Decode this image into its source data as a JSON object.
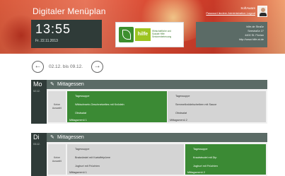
{
  "header": {
    "title": "Digitaler Menüplan",
    "time": "13:55",
    "date": "Fr. 22.11.2013",
    "user_name": "SoftAware",
    "user_links": "Passwort ändern  Administration  Logout",
    "logo": {
      "brand": "hilfe",
      "line1": "Wirtschaftliche und",
      "line2": "Soziale Hilfe",
      "line3": "Seniorenbetreuung"
    },
    "address": [
      "hilfe.de Straße",
      "Seestraße 27",
      "4400 St. Florian",
      "http://www.hilfe.at.de"
    ]
  },
  "week_nav": {
    "prev_icon": "arrow-left-icon",
    "next_icon": "arrow-right-icon",
    "range": "02.12. bis 09.12.",
    "prev_glyph": "←",
    "next_glyph": "→"
  },
  "days": [
    {
      "abbr": "Mo",
      "date": "02.12.",
      "section": "Mittagessen",
      "no_choice": [
        "Keine",
        "Auswahl"
      ],
      "menus": [
        {
          "style": "green",
          "items": [
            "Tagessuppe",
            "Wildschwein-Geschnetzeltes mit Knödeln",
            "Obstsalat"
          ],
          "footer": "Mittagsmenü 1"
        },
        {
          "style": "gray",
          "items": [
            "Tagessuppe",
            "Semmelknödelscheiben mit Sauce",
            "Obstsalat"
          ],
          "footer": "Mittagsmenü 2"
        }
      ]
    },
    {
      "abbr": "Di",
      "date": "03.12.",
      "section": "Mittagessen",
      "no_choice": [
        "Keine",
        "Auswahl"
      ],
      "menus": [
        {
          "style": "gray",
          "items": [
            "Tagessuppe",
            "Bratwürstel mit Kartoffelpüree",
            "Joghurt mit Früchten"
          ],
          "footer": "Mittagsmenü 1"
        },
        {
          "style": "green",
          "items": [
            "Tagessuppe",
            "Krautstrudel mit Dip",
            "Joghurt mit Früchten"
          ],
          "footer": "Mittagsmenü 2"
        }
      ]
    }
  ],
  "colors": {
    "accent_green": "#3b8a34",
    "dark": "#2f3b38",
    "bar": "#5b6b66",
    "header_red": "#d9462f"
  }
}
